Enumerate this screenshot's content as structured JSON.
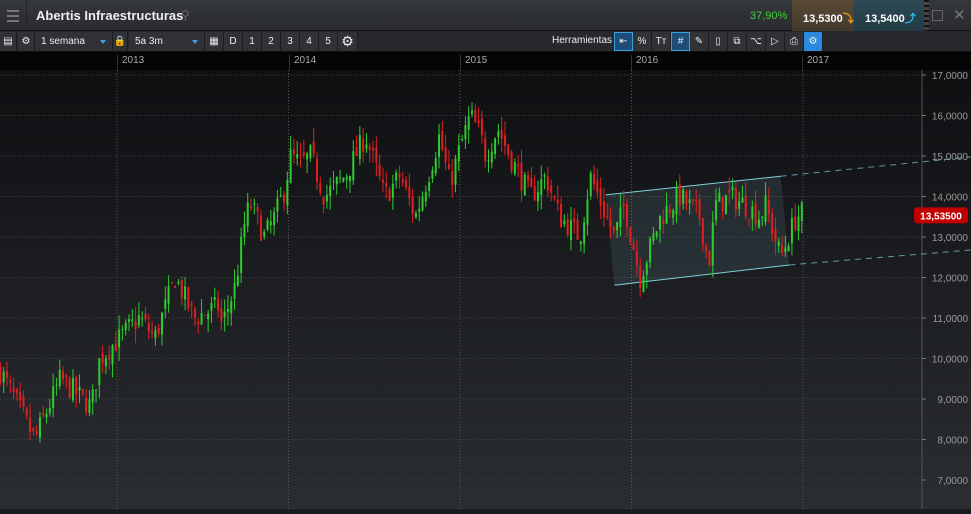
{
  "header": {
    "title": "Abertis Infraestructuras",
    "change": "37,90%",
    "sell": "13,5300",
    "buy": "13,5400"
  },
  "toolbar": {
    "interval": "1 semana",
    "range": "5a 3m",
    "buttons": [
      "D",
      "1",
      "2",
      "3",
      "4",
      "5"
    ],
    "tools_label": "Herramientas",
    "tool_icons": [
      "arrow-in-icon",
      "percent-icon",
      "text-size-icon",
      "grid-icon",
      "draw-icon",
      "candle-icon",
      "layers-icon",
      "indicator-icon",
      "tag-icon",
      "print-icon",
      "settings-tool-icon"
    ]
  },
  "chart_data": {
    "type": "candlestick",
    "interval": "weekly",
    "x_ticks": [
      "2013",
      "2014",
      "2015",
      "2016",
      "2017"
    ],
    "y_ticks": [
      "17,0000",
      "16,0000",
      "15,0000",
      "14,0000",
      "13,0000",
      "12,0000",
      "11,0000",
      "10,0000",
      "9,0000",
      "8,0000",
      "7,0000"
    ],
    "ylim": [
      7,
      17
    ],
    "xlim": [
      2012.32,
      2017.98
    ],
    "last_price_label": "13,53500",
    "last_price": 13.535,
    "price_path": [
      [
        2012.32,
        9.7
      ],
      [
        2012.52,
        8.0
      ],
      [
        2012.67,
        9.5
      ],
      [
        2012.85,
        8.8
      ],
      [
        2012.9,
        10.0
      ],
      [
        2013.13,
        11.0
      ],
      [
        2013.22,
        10.5
      ],
      [
        2013.34,
        12.0
      ],
      [
        2013.45,
        11.0
      ],
      [
        2013.6,
        11.3
      ],
      [
        2013.61,
        10.8
      ],
      [
        2013.69,
        11.8
      ],
      [
        2013.75,
        13.5
      ],
      [
        2013.78,
        13.8
      ],
      [
        2013.86,
        13.0
      ],
      [
        2013.92,
        13.5
      ],
      [
        2013.98,
        14.2
      ],
      [
        2014.01,
        15.0
      ],
      [
        2014.07,
        14.8
      ],
      [
        2014.13,
        15.0
      ],
      [
        2014.21,
        14.0
      ],
      [
        2014.33,
        14.5
      ],
      [
        2014.45,
        15.5
      ],
      [
        2014.56,
        14.0
      ],
      [
        2014.65,
        14.5
      ],
      [
        2014.74,
        13.5
      ],
      [
        2014.8,
        14.3
      ],
      [
        2014.88,
        15.5
      ],
      [
        2014.94,
        14.3
      ],
      [
        2015.0,
        15.2
      ],
      [
        2015.06,
        16.0
      ],
      [
        2015.12,
        15.5
      ],
      [
        2015.15,
        15.0
      ],
      [
        2015.22,
        15.7
      ],
      [
        2015.29,
        15.0
      ],
      [
        2015.41,
        14.0
      ],
      [
        2015.5,
        14.5
      ],
      [
        2015.58,
        13.5
      ],
      [
        2015.7,
        13.0
      ],
      [
        2015.76,
        14.5
      ],
      [
        2015.9,
        13.0
      ],
      [
        2015.96,
        13.8
      ],
      [
        2016.05,
        12.0
      ],
      [
        2016.17,
        13.5
      ],
      [
        2016.28,
        14.0
      ],
      [
        2016.4,
        13.5
      ],
      [
        2016.45,
        12.3
      ],
      [
        2016.49,
        13.8
      ],
      [
        2016.58,
        14.0
      ],
      [
        2016.66,
        13.8
      ],
      [
        2016.75,
        13.5
      ],
      [
        2016.78,
        13.8
      ],
      [
        2016.87,
        12.5
      ],
      [
        2016.96,
        13.5
      ],
      [
        2017.0,
        13.6
      ]
    ],
    "channel": {
      "upper": [
        [
          2015.85,
          14.04
        ],
        [
          2016.87,
          14.5
        ],
        [
          2017.98,
          14.98
        ]
      ],
      "lower": [
        [
          2015.9,
          11.81
        ],
        [
          2016.92,
          12.31
        ],
        [
          2017.98,
          12.68
        ]
      ]
    },
    "colors": {
      "up": "#2ecc2e",
      "down": "#e02020",
      "channel": "#7fd0d8",
      "label": "#c00000"
    }
  }
}
